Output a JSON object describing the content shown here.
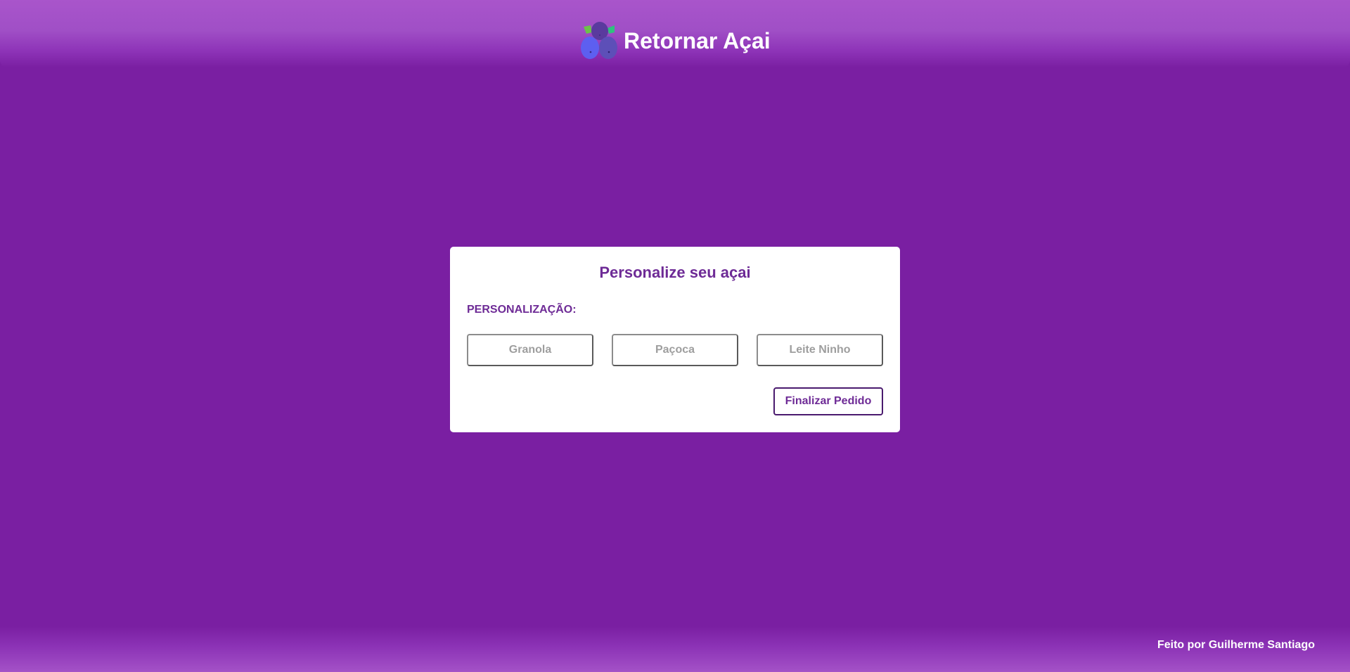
{
  "header": {
    "title": "Retornar Açai",
    "logo_icon": "acai-berries-icon"
  },
  "card": {
    "title": "Personalize seu açai",
    "section_label": "PERSONALIZAÇÃO:",
    "options": [
      {
        "label": "Granola"
      },
      {
        "label": "Paçoca"
      },
      {
        "label": "Leite Ninho"
      }
    ],
    "finish_label": "Finalizar Pedido"
  },
  "footer": {
    "credit": "Feito por Guilherme Santiago"
  },
  "colors": {
    "background": "#7a1fa2",
    "header_top": "#a955cb",
    "card_text": "#6e2b96",
    "option_text": "#9e9e9e",
    "button_border": "#4a1a6e"
  }
}
